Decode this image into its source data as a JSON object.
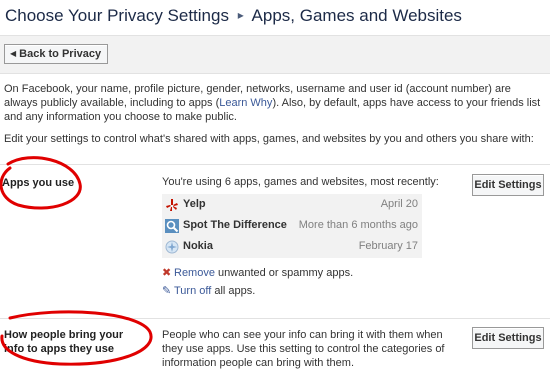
{
  "breadcrumb": {
    "parent": "Choose Your Privacy Settings",
    "separator": "▸",
    "current": "Apps, Games and Websites"
  },
  "toolbar": {
    "back_label": "Back to Privacy"
  },
  "intro": {
    "p1_before": "On Facebook, your name, profile picture, gender, networks, username and user id (account number) are always publicly available, including to apps (",
    "p1_link": "Learn Why",
    "p1_after": "). Also, by default, apps have access to your friends list and any information you choose to make public.",
    "p2": "Edit your settings to control what's shared with apps, games, and websites by you and others you share with:"
  },
  "apps_you_use": {
    "title": "Apps you use",
    "summary": "You're using 6 apps, games and websites, most recently:",
    "edit_label": "Edit Settings",
    "apps": [
      {
        "name": "Yelp",
        "date": "April 20",
        "icon": "yelp-icon"
      },
      {
        "name": "Spot The Difference",
        "date": "More than 6 months ago",
        "icon": "spot-the-difference-icon"
      },
      {
        "name": "Nokia",
        "date": "February 17",
        "icon": "nokia-icon"
      }
    ],
    "remove_link": "Remove",
    "remove_rest": " unwanted or spammy apps.",
    "turnoff_link": "Turn off",
    "turnoff_rest": " all apps."
  },
  "info_via_friends": {
    "title": "How people bring your info to apps they use",
    "description": "People who can see your info can bring it with them when they use apps. Use this setting to control the categories of information people can bring with them.",
    "edit_label": "Edit Settings"
  },
  "colors": {
    "link": "#3b5998",
    "annotation": "#e00000",
    "panel": "#f2f2f2"
  }
}
